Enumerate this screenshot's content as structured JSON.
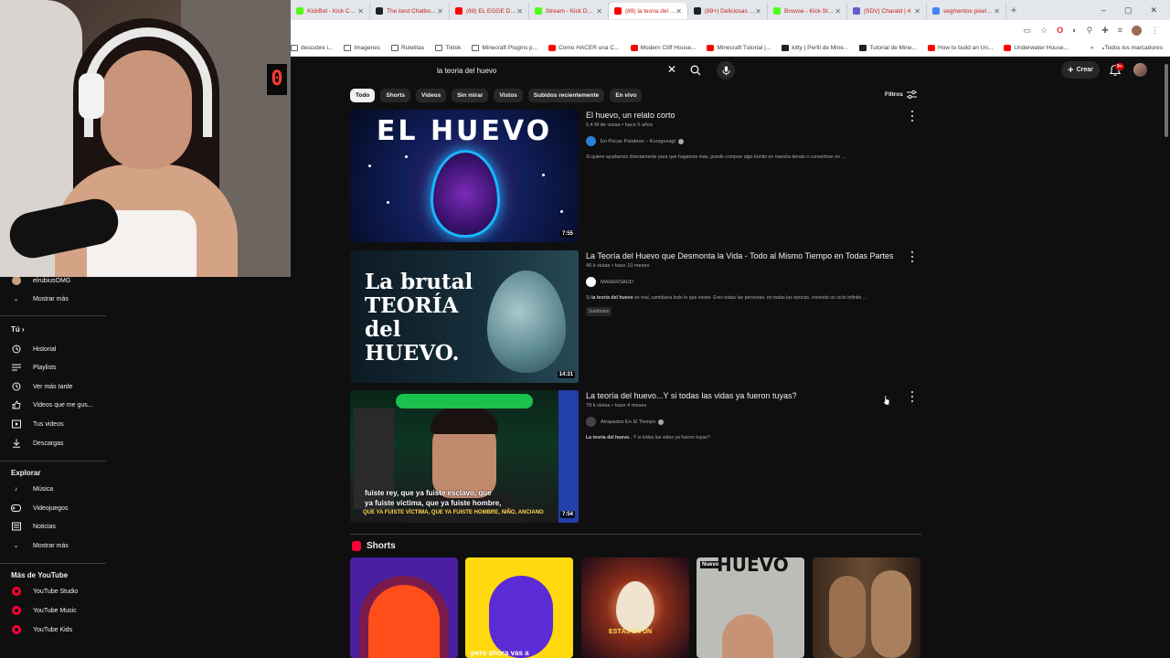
{
  "browser": {
    "tabs": [
      {
        "label": "KickBot - Kick Chatbo",
        "color": "#53fc18"
      },
      {
        "label": "The best Chatbot and",
        "color": "#202124"
      },
      {
        "label": "(89) EL EGGE DE DARI",
        "color": "#ff0000"
      },
      {
        "label": "Stream - Kick Dashbo",
        "color": "#53fc18"
      },
      {
        "label": "(89) la teoria del huevo",
        "color": "#ff0000"
      },
      {
        "label": "(89+) Deliciosas receta",
        "color": "#202124"
      },
      {
        "label": "Browse - Kick Stream",
        "color": "#53fc18"
      },
      {
        "label": "(SDV) Charaid | 4",
        "color": "#6a5acd"
      },
      {
        "label": "segmentos pixeles - b",
        "color": "#4285f4"
      }
    ],
    "active_tab_index": 4,
    "window_controls": [
      "–",
      "▢",
      "✕"
    ],
    "bookmarks": [
      {
        "label": "descubre i...",
        "icon": "folder"
      },
      {
        "label": "Imagenes",
        "icon": "folder"
      },
      {
        "label": "Ruletitas",
        "icon": "folder"
      },
      {
        "label": "Tiktok",
        "icon": "folder"
      },
      {
        "label": "Minecraft Plugins p...",
        "icon": "folder"
      },
      {
        "label": "Como HACER una C...",
        "icon": "yt"
      },
      {
        "label": "Modern Cliff House...",
        "icon": "yt"
      },
      {
        "label": "Minecraft Tutorial |...",
        "icon": "yt"
      },
      {
        "label": "kitty | Perfil de Mine...",
        "icon": "dark"
      },
      {
        "label": "Tutorial de Mine...",
        "icon": "dark"
      },
      {
        "label": "How to build an Un...",
        "icon": "yt"
      },
      {
        "label": "Underwater House...",
        "icon": "yt"
      }
    ],
    "bookmarks_more": "»",
    "all_bookmarks": "Todos los marcadores"
  },
  "webcam": {
    "clock_digit": "0"
  },
  "youtube": {
    "search_query": "la teoria del huevo",
    "create_label": "Crear",
    "notif_badge": "9+",
    "chips": [
      "Todo",
      "Shorts",
      "Videos",
      "Sin mirar",
      "Vistos",
      "Subidos recientemente",
      "En vivo"
    ],
    "filters_label": "Filtros",
    "results": [
      {
        "title": "El huevo, un relato corto",
        "meta": "5,4 M de vistas • hace 5 años",
        "channel": "En Pocas Palabras – Kurzgesagt",
        "desc_bold": "",
        "desc": "Si quiere ayudarnos directamente para que hagamos más, puede comprar algo bonito en nuestra tienda o convertirse en ...",
        "duration": "7:55",
        "badge": "",
        "thumb_text": "EL HUEVO"
      },
      {
        "title": "La Teoría del Huevo que Desmonta la Vida - Todo al Mismo Tiempo en Todas Partes",
        "meta": "40 k vistas • hace 10 meses",
        "channel": "MAHERSAUD",
        "desc_bold": "la teoría del huevo",
        "desc_pre": "Si ",
        "desc": " es real, cambiaría todo lo que existe. Eres todas las personas, en todas las épocas, viviendo un ciclo infinito ...",
        "duration": "14:31",
        "badge": "Subtítulos",
        "thumb_lines": [
          "La brutal",
          "TEORÍA",
          "del",
          "HUEVO."
        ]
      },
      {
        "title": "La teoría del huevo...Y si todas las vidas ya fueron tuyas?",
        "meta": "78 k vistas • hace 4 meses",
        "channel": "Atrapados En El Tiempo",
        "desc_bold": "La teoría del huevo",
        "desc": "...Y si todas las vidas ya fueron tuyas?",
        "duration": "7:54",
        "badge": "",
        "thumb_sub": [
          "fuiste rey, que ya fuiste esclavo, que",
          "ya fuiste víctima, que ya fuiste hombre,"
        ],
        "thumb_sub2": "QUE YA FUISTE VÍCTIMA, QUE YA FUISTE HOMBRE, NIÑO, ANCIANO"
      }
    ],
    "shorts_label": "Shorts",
    "shorts": [
      {
        "text": ""
      },
      {
        "text": "pero ahora vas a"
      },
      {
        "text": "ESTÁS EN UN"
      },
      {
        "text": "HUEVO",
        "tag": "Nuevo"
      },
      {
        "text": ""
      }
    ]
  },
  "sidebar": {
    "top_channel": "elrubiusOMG",
    "show_more": "Mostrar más",
    "you_label": "Tú",
    "you_items": [
      {
        "label": "Historial",
        "icon": "history-icon"
      },
      {
        "label": "Playlists",
        "icon": "playlist-icon"
      },
      {
        "label": "Ver más tarde",
        "icon": "watch-later-icon"
      },
      {
        "label": "Videos que me gus...",
        "icon": "like-icon"
      },
      {
        "label": "Tus videos",
        "icon": "your-videos-icon"
      },
      {
        "label": "Descargas",
        "icon": "download-icon"
      }
    ],
    "explore_label": "Explorar",
    "explore_items": [
      {
        "label": "Música",
        "icon": "music-icon"
      },
      {
        "label": "Videojuegos",
        "icon": "gaming-icon"
      },
      {
        "label": "Noticias",
        "icon": "news-icon"
      },
      {
        "label": "Mostrar más",
        "icon": "chevron-down-icon"
      }
    ],
    "more_label": "Más de YouTube",
    "more_items": [
      {
        "label": "YouTube Studio"
      },
      {
        "label": "YouTube Music"
      },
      {
        "label": "YouTube Kids"
      }
    ]
  }
}
